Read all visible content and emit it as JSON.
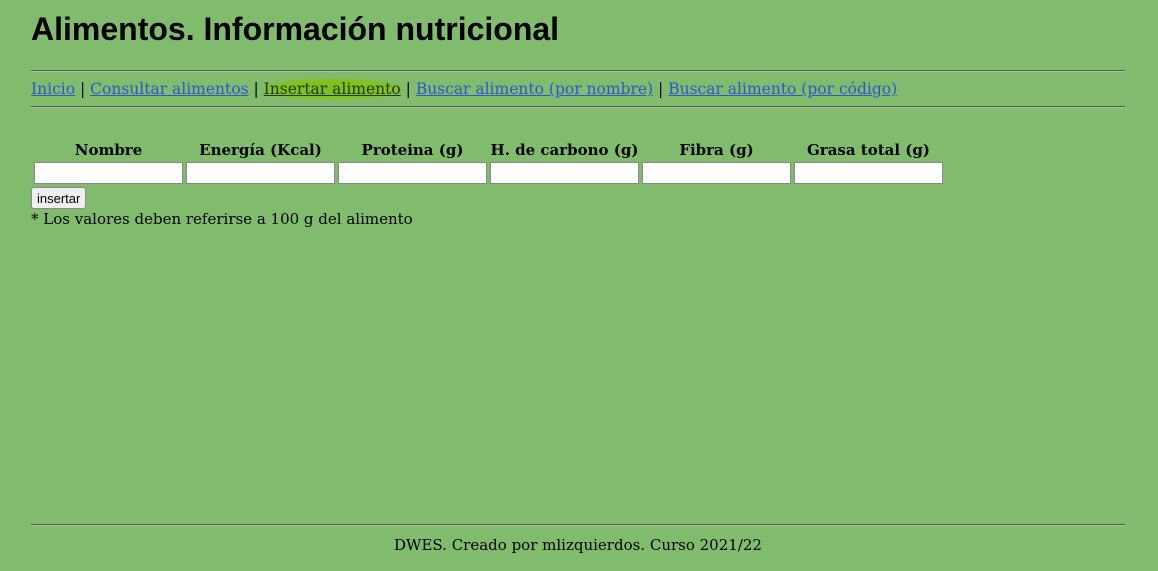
{
  "header": {
    "title": "Alimentos. Información nutricional"
  },
  "nav": {
    "items": [
      {
        "label": "Inicio",
        "active": false
      },
      {
        "label": "Consultar alimentos",
        "active": false
      },
      {
        "label": "Insertar alimento",
        "active": true
      },
      {
        "label": "Buscar alimento (por nombre)",
        "active": false
      },
      {
        "label": "Buscar alimento (por código)",
        "active": false
      }
    ],
    "separator": "|"
  },
  "form": {
    "columns": [
      {
        "header": "Nombre",
        "value": "",
        "placeholder": ""
      },
      {
        "header": "Energía (Kcal)",
        "value": "",
        "placeholder": ""
      },
      {
        "header": "Proteina (g)",
        "value": "",
        "placeholder": ""
      },
      {
        "header": "H. de carbono (g)",
        "value": "",
        "placeholder": ""
      },
      {
        "header": "Fibra (g)",
        "value": "",
        "placeholder": ""
      },
      {
        "header": "Grasa total (g)",
        "value": "",
        "placeholder": ""
      }
    ],
    "submit_label": "insertar",
    "note": "* Los valores deben referirse a 100 g del alimento"
  },
  "footer": {
    "text": "DWES. Creado por mlizquierdos. Curso 2021/22"
  },
  "colors": {
    "background": "#80bb6e",
    "link": "#3355cc",
    "active_highlight": "#7cbf1a"
  }
}
